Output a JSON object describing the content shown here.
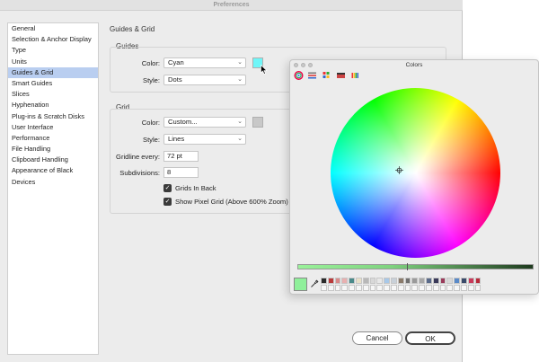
{
  "window": {
    "title": "Preferences"
  },
  "sidebar": {
    "items": [
      {
        "label": "General"
      },
      {
        "label": "Selection & Anchor Display"
      },
      {
        "label": "Type"
      },
      {
        "label": "Units"
      },
      {
        "label": "Guides & Grid",
        "selected": true
      },
      {
        "label": "Smart Guides"
      },
      {
        "label": "Slices"
      },
      {
        "label": "Hyphenation"
      },
      {
        "label": "Plug-ins & Scratch Disks"
      },
      {
        "label": "User Interface"
      },
      {
        "label": "Performance"
      },
      {
        "label": "File Handling"
      },
      {
        "label": "Clipboard Handling"
      },
      {
        "label": "Appearance of Black"
      },
      {
        "label": "Devices"
      }
    ]
  },
  "main": {
    "section_title": "Guides & Grid",
    "guides": {
      "group_label": "Guides",
      "color_label": "Color:",
      "color_value": "Cyan",
      "color_swatch": "#6ff6f8",
      "style_label": "Style:",
      "style_value": "Dots"
    },
    "grid": {
      "group_label": "Grid",
      "color_label": "Color:",
      "color_value": "Custom...",
      "color_swatch": "#c8c8c8",
      "style_label": "Style:",
      "style_value": "Lines",
      "gridline_label": "Gridline every:",
      "gridline_value": "72 pt",
      "subdivisions_label": "Subdivisions:",
      "subdivisions_value": "8",
      "grids_in_back": "Grids In Back",
      "show_pixel_grid": "Show Pixel Grid (Above 600% Zoom)"
    },
    "buttons": {
      "cancel": "Cancel",
      "ok": "OK"
    }
  },
  "colors_panel": {
    "title": "Colors",
    "current_color": "#8ff09a",
    "palette_swatches": [
      "#2a2a2a",
      "#b93a3a",
      "#d98a8a",
      "#e8b0b0",
      "#4a8a8a",
      "#e8e0c8",
      "#b8b8b8",
      "#d8d8d8",
      "#e8e8e8",
      "#a8c8e8",
      "#c8d0d8",
      "#8a7a6a",
      "#707070",
      "#9a9a9a",
      "#a8a8a8",
      "#5a6a8a",
      "#3a3a5a",
      "#9a3a5a",
      "#d8d8d8",
      "#5a8ac8",
      "#3a4a6a",
      "#c83a5a",
      "#b82a3a"
    ]
  }
}
